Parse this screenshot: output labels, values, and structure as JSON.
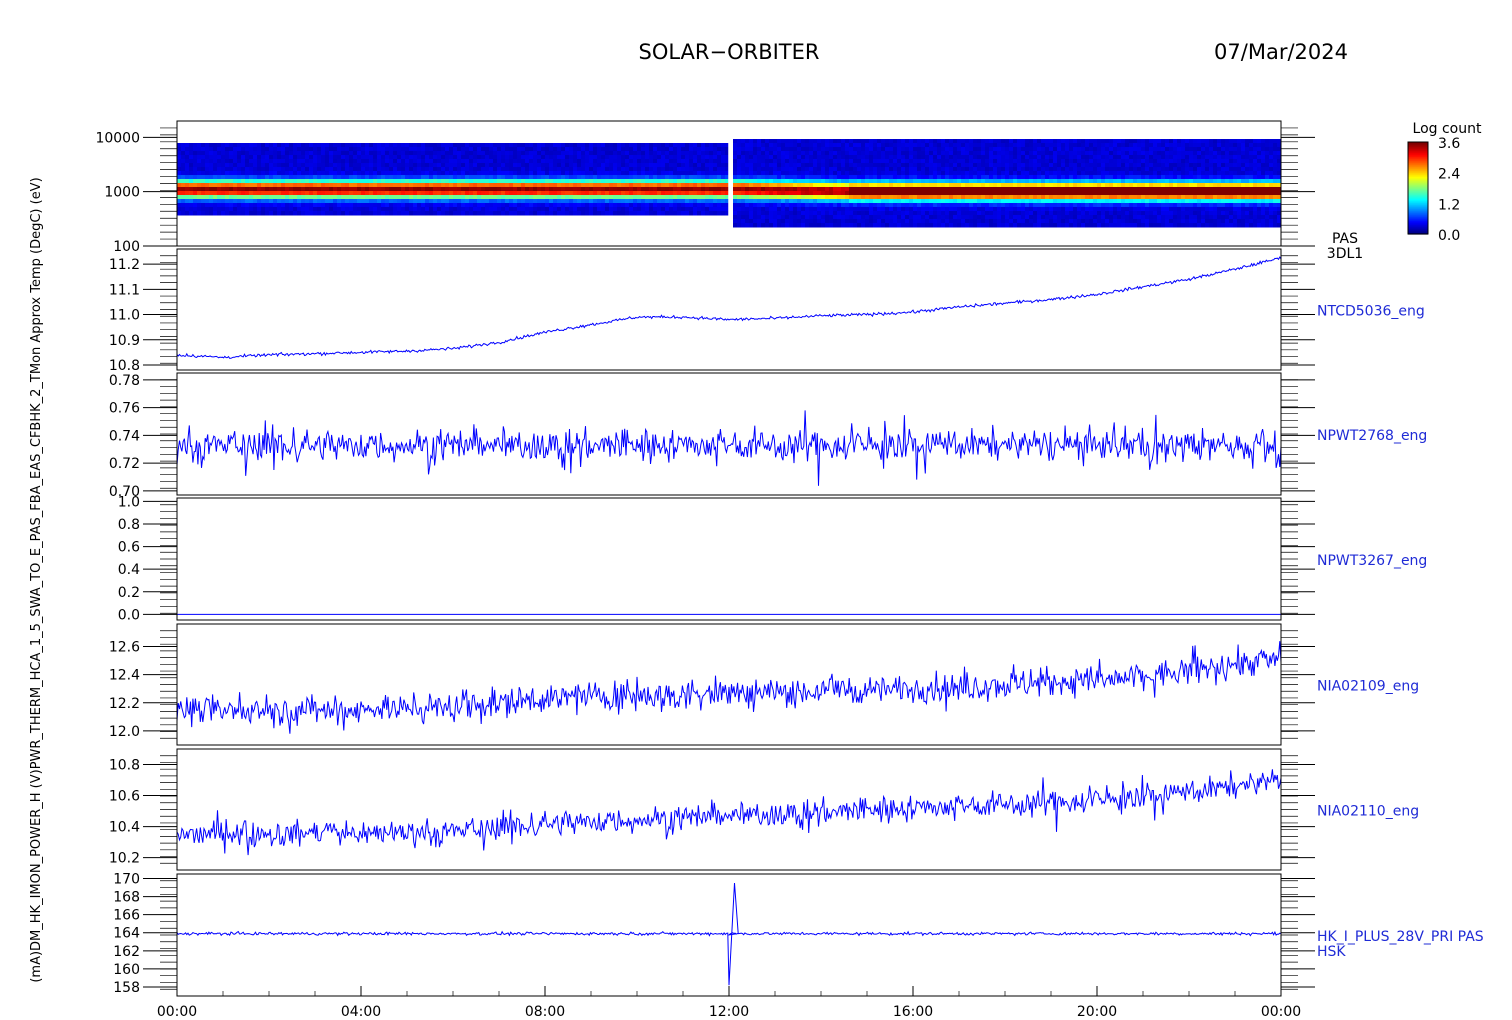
{
  "header": {
    "title": "SOLAR−ORBITER",
    "date": "07/Mar/2024"
  },
  "colors": {
    "line": "#0000ff",
    "label": "#1f2bd6",
    "spectrogram_background": "#00008b"
  },
  "colorbar": {
    "label": "Log count",
    "ticks": [
      "3.6",
      "2.4",
      "1.2",
      "0.0"
    ],
    "range": [
      0.0,
      3.6
    ],
    "colormap": "jet"
  },
  "ylabel_overlay": "(mA)DM_HK_IMON_POWER_H (V)PWR_THERM_HCA_1_5_SWA_TO_E_PAS_FBA_EAS_CFBHK_2_TMon Approx Temp (DegC) (eV)",
  "chart_data": [
    {
      "type": "heatmap",
      "panel": "PAS 3DL1",
      "right_label": [
        "PAS",
        "3DL1"
      ],
      "ylabel": "(eV)",
      "yscale": "log",
      "ylim": [
        100,
        20000
      ],
      "yticks": [
        "10000",
        "1000",
        "100"
      ],
      "ytick_values": [
        10000,
        1000,
        100
      ],
      "x": [
        "00:00",
        "04:00",
        "08:00",
        "12:00",
        "16:00",
        "20:00",
        "00:00"
      ],
      "peak_energy_eV": [
        {
          "t": "00:00",
          "e": 1200
        },
        {
          "t": "12:00",
          "e": 1200
        },
        {
          "t": "14:40",
          "e": 1100
        },
        {
          "t": "00:00",
          "e": 1100
        }
      ],
      "data_gap": "12:00"
    },
    {
      "type": "line",
      "panel": "NTCD5036_eng",
      "right_label": [
        "NTCD5036_eng"
      ],
      "ylabel": "Approx Temp (DegC)",
      "ylim": [
        10.78,
        11.26
      ],
      "yticks": [
        "11.2",
        "11.1",
        "11.0",
        "10.9",
        "10.8"
      ],
      "ytick_values": [
        11.2,
        11.1,
        11.0,
        10.9,
        10.8
      ],
      "series": [
        {
          "x": [
            "00:00",
            "01:00",
            "02:00",
            "03:00",
            "04:00",
            "05:00",
            "06:00",
            "07:00",
            "08:00",
            "09:00",
            "10:00",
            "11:00",
            "12:00",
            "13:00",
            "14:00",
            "15:00",
            "16:00",
            "17:00",
            "18:00",
            "19:00",
            "20:00",
            "21:00",
            "22:00",
            "23:00",
            "24:00"
          ],
          "values": [
            10.84,
            10.83,
            10.84,
            10.845,
            10.85,
            10.855,
            10.865,
            10.89,
            10.93,
            10.96,
            10.99,
            10.99,
            10.98,
            10.985,
            10.995,
            11.0,
            11.01,
            11.03,
            11.045,
            11.06,
            11.08,
            11.11,
            11.14,
            11.18,
            11.225
          ],
          "noise": 0.003
        }
      ]
    },
    {
      "type": "line",
      "panel": "NPWT2768_eng",
      "right_label": [
        "NPWT2768_eng"
      ],
      "ylim": [
        0.697,
        0.785
      ],
      "yticks": [
        "0.78",
        "0.76",
        "0.74",
        "0.72",
        "0.70"
      ],
      "ytick_values": [
        0.78,
        0.76,
        0.74,
        0.72,
        0.7
      ],
      "series": [
        {
          "x": [
            "00:00",
            "12:00",
            "24:00"
          ],
          "values": [
            0.733,
            0.733,
            0.733
          ],
          "noise": 0.0055,
          "spikes": 0.018
        }
      ]
    },
    {
      "type": "line",
      "panel": "NPWT3267_eng",
      "right_label": [
        "NPWT3267_eng"
      ],
      "ylim": [
        -0.05,
        1.03
      ],
      "yticks": [
        "1.0",
        "0.8",
        "0.6",
        "0.4",
        "0.2",
        "0.0"
      ],
      "ytick_values": [
        1.0,
        0.8,
        0.6,
        0.4,
        0.2,
        0.0
      ],
      "series": [
        {
          "x": [
            "00:00",
            "24:00"
          ],
          "values": [
            0.0,
            0.0
          ],
          "noise": 0
        }
      ]
    },
    {
      "type": "line",
      "panel": "NIA02109_eng",
      "right_label": [
        "NIA02109_eng"
      ],
      "ylim": [
        11.9,
        12.76
      ],
      "yticks": [
        "12.6",
        "12.4",
        "12.2",
        "12.0"
      ],
      "ytick_values": [
        12.6,
        12.4,
        12.2,
        12.0
      ],
      "series": [
        {
          "x": [
            "00:00",
            "04:00",
            "06:00",
            "08:00",
            "12:00",
            "16:00",
            "20:00",
            "22:00",
            "24:00"
          ],
          "values": [
            12.14,
            12.15,
            12.17,
            12.23,
            12.27,
            12.3,
            12.36,
            12.42,
            12.52
          ],
          "noise": 0.05,
          "spikes": 0.12
        }
      ]
    },
    {
      "type": "line",
      "panel": "NIA02110_eng",
      "right_label": [
        "NIA02110_eng"
      ],
      "ylim": [
        10.12,
        10.9
      ],
      "yticks": [
        "10.8",
        "10.6",
        "10.4",
        "10.2"
      ],
      "ytick_values": [
        10.8,
        10.6,
        10.4,
        10.2
      ],
      "series": [
        {
          "x": [
            "00:00",
            "04:00",
            "06:00",
            "08:00",
            "12:00",
            "16:00",
            "20:00",
            "22:00",
            "24:00"
          ],
          "values": [
            10.35,
            10.36,
            10.37,
            10.42,
            10.47,
            10.52,
            10.57,
            10.62,
            10.7
          ],
          "noise": 0.04,
          "spikes": 0.11
        }
      ]
    },
    {
      "type": "line",
      "panel": "HK_I_PLUS_28V_PRI PAS HSK",
      "right_label": [
        "HK_I_PLUS_28V_PRI PAS",
        "HSK"
      ],
      "ylabel": "(mA)",
      "ylim": [
        157,
        170.5
      ],
      "yticks": [
        "170",
        "168",
        "166",
        "164",
        "162",
        "160",
        "158"
      ],
      "ytick_values": [
        170,
        168,
        166,
        164,
        162,
        160,
        158
      ],
      "series": [
        {
          "x": [
            "00:00",
            "24:00"
          ],
          "values": [
            163.9,
            163.9
          ],
          "noise": 0.08,
          "excursion": [
            {
              "t": "12:00",
              "min": 158.2,
              "max": 169.5
            }
          ]
        }
      ]
    }
  ],
  "xaxis": {
    "ticks": [
      "00:00",
      "04:00",
      "08:00",
      "12:00",
      "16:00",
      "20:00",
      "00:00"
    ]
  }
}
